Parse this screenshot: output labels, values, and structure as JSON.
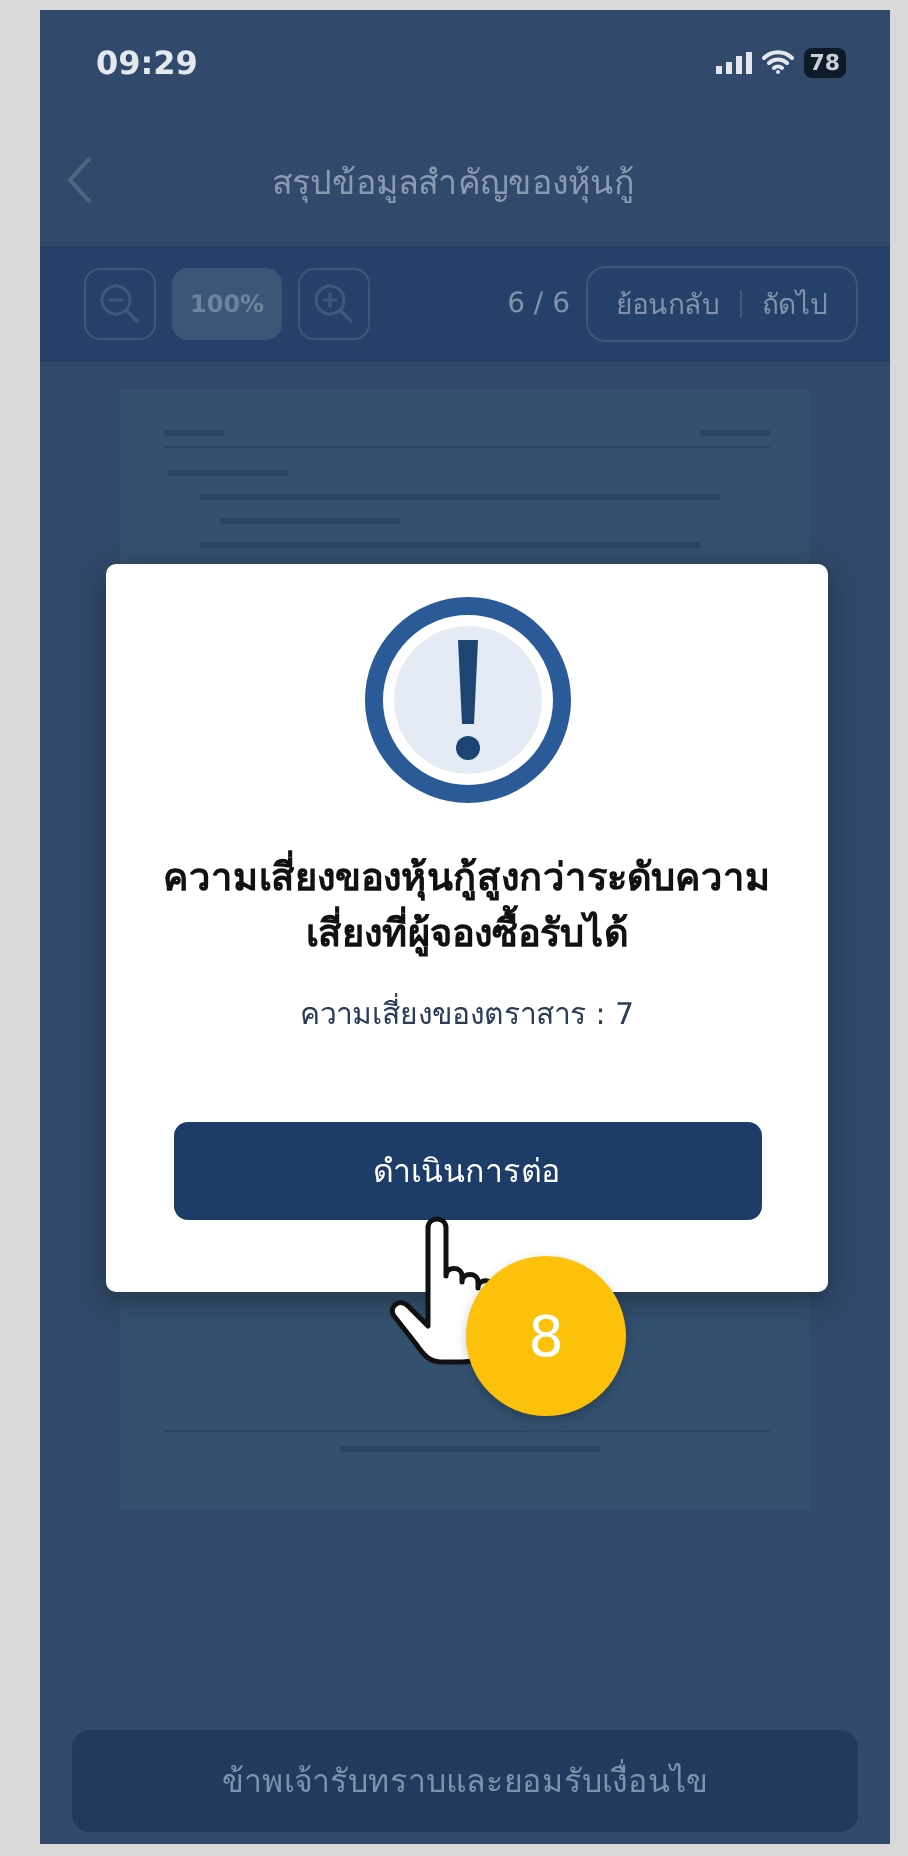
{
  "status_bar": {
    "time": "09:29",
    "battery": "78"
  },
  "header": {
    "title": "สรุปข้อมูลสำคัญของหุ้นกู้"
  },
  "toolbar": {
    "zoom": "100%",
    "page": "6 / 6",
    "back": "ย้อนกลับ",
    "next": "ถัดไป"
  },
  "footer_button": {
    "label": "ข้าพเจ้ารับทราบและยอมรับเงื่อนไข"
  },
  "dialog": {
    "title": "ความเสี่ยงของหุ้นกู้สูงกว่าระดับความเสี่ยงที่ผู้จองซื้อรับได้",
    "subtitle": "ความเสี่ยงของตราสาร : 7",
    "button": "ดำเนินการต่อ"
  },
  "step_badge": {
    "label": "8"
  }
}
